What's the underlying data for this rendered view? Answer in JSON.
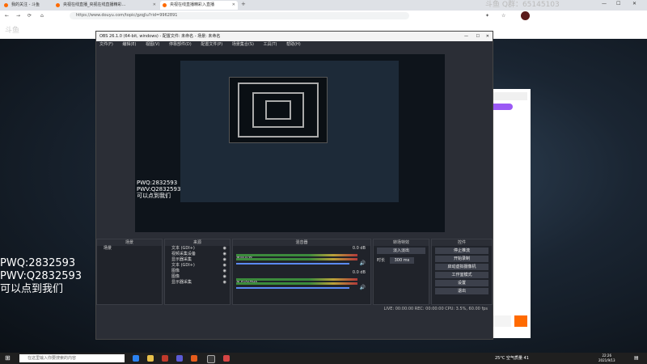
{
  "browser": {
    "tabs": [
      {
        "label": "我的关注 - 斗鱼",
        "active": false
      },
      {
        "label": "央视在线直播_央视在线直播精彩…",
        "active": false
      },
      {
        "label": "央视在线直播精彩入直播",
        "active": true
      }
    ],
    "address": "https://www.douyu.com/topic/gzqjlu?rid=9962891",
    "watermark": "斗鱼 Q群：65145103"
  },
  "obs": {
    "title": "OBS 26.1.0 (64-bit, windows) - 配置文件: 未命名 - 场景: 未命名",
    "menu": [
      "文件(F)",
      "编辑(E)",
      "视图(V)",
      "停靠部件(D)",
      "配置文件(P)",
      "场景集合(S)",
      "工具(T)",
      "帮助(H)"
    ],
    "preview_overlay": [
      "PWQ:2832593",
      "PWV:Q2832593",
      "可以点到我们"
    ],
    "docks": {
      "scenes": {
        "title": "场景",
        "items": [
          "场景"
        ]
      },
      "sources": {
        "title": "来源",
        "items": [
          "文本 (GDI+)",
          "视频采集设备",
          "显示器采集",
          "文本 (GDI+)",
          "图像",
          "图像",
          "显示器采集"
        ]
      },
      "mixer": {
        "title": "混音器",
        "tracks": [
          {
            "name": "桌面音频",
            "level": "0.0 dB"
          },
          {
            "name": "麦克风/Aux",
            "level": "0.0 dB"
          }
        ]
      },
      "transitions": {
        "title": "转场特效",
        "type": "淡入淡出",
        "duration_label": "时长",
        "duration": "300 ms"
      },
      "controls": {
        "title": "控件",
        "buttons": [
          "停止推流",
          "开始录制",
          "启动虚拟摄像机",
          "工作室模式",
          "设置",
          "退出"
        ]
      }
    },
    "statusbar": "LIVE: 00:00:00   REC: 00:00:00   CPU: 3.5%, 60.00 fps"
  },
  "overlay_text": [
    "PWQ:2832593",
    "PWV:Q2832593",
    "可以点到我们"
  ],
  "taskbar": {
    "search_placeholder": "在这里输入你要搜索的内容",
    "weather": "25°C 空气质量 41",
    "time": "22:26",
    "date": "2021/9/13"
  }
}
